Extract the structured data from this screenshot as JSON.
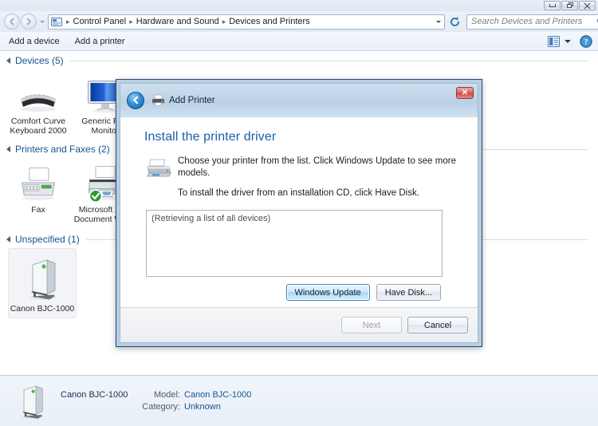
{
  "window": {
    "buttons": [
      {
        "name": "minimize",
        "label": "Minimize"
      },
      {
        "name": "restore",
        "label": "Restore"
      },
      {
        "name": "close",
        "label": "Close"
      }
    ]
  },
  "address_bar": {
    "breadcrumbs": [
      "Control Panel",
      "Hardware and Sound",
      "Devices and Printers"
    ],
    "separator": "▸",
    "icon": "control-panel-icon",
    "dropdown_icon": "chevron-down-icon",
    "refresh_icon": "refresh-icon"
  },
  "search": {
    "placeholder": "Search Devices and Printers",
    "icon": "search-icon"
  },
  "command_bar": {
    "items": [
      {
        "label": "Add a device",
        "name": "add-a-device"
      },
      {
        "label": "Add a printer",
        "name": "add-a-printer"
      }
    ],
    "view_icon": "view-layout-icon",
    "view_dropdown_icon": "chevron-down-icon",
    "help_icon": "help-icon"
  },
  "content": {
    "groups": [
      {
        "title": "Devices (5)",
        "name": "devices",
        "items": [
          {
            "label": "Comfort Curve Keyboard 2000",
            "icon": "keyboard-icon",
            "selected": false
          },
          {
            "label": "Generic PnP Monitor",
            "icon": "monitor-icon",
            "selected": false
          }
        ]
      },
      {
        "title": "Printers and Faxes (2)",
        "name": "printers-and-faxes",
        "items": [
          {
            "label": "Fax",
            "icon": "fax-icon",
            "selected": false
          },
          {
            "label": "Microsoft XPS Document Writer",
            "icon": "printer-default-icon",
            "selected": false
          }
        ]
      },
      {
        "title": "Unspecified (1)",
        "name": "unspecified",
        "items": [
          {
            "label": "Canon BJC-1000",
            "icon": "unknown-device-icon",
            "selected": true
          }
        ]
      }
    ]
  },
  "details_pane": {
    "icon": "unknown-device-icon",
    "device_name": "Canon BJC-1000",
    "rows": [
      {
        "key": "Model:",
        "value": "Canon BJC-1000"
      },
      {
        "key": "Category:",
        "value": "Unknown"
      }
    ]
  },
  "dialog": {
    "title": "Add Printer",
    "title_icon": "printer-icon",
    "back_icon": "back-arrow-icon",
    "close_label": "✕",
    "heading": "Install the printer driver",
    "intro_icon": "printer-large-icon",
    "intro_lines": [
      "Choose your printer from the list. Click Windows Update to see more models.",
      "To install the driver from an installation CD, click Have Disk."
    ],
    "listbox_message": "(Retrieving a list of all devices)",
    "mid_buttons": [
      {
        "label": "Windows Update",
        "name": "windows-update-button",
        "style": "default"
      },
      {
        "label": "Have Disk...",
        "name": "have-disk-button",
        "style": "normal"
      }
    ],
    "footer_buttons": [
      {
        "label": "Next",
        "name": "next-button",
        "style": "disabled"
      },
      {
        "label": "Cancel",
        "name": "cancel-button",
        "style": "normal"
      }
    ]
  },
  "colors": {
    "accent_blue": "#1660a8",
    "group_header": "#17528f",
    "dialog_border": "#2d4a63",
    "close_red": "#cf4a46"
  }
}
